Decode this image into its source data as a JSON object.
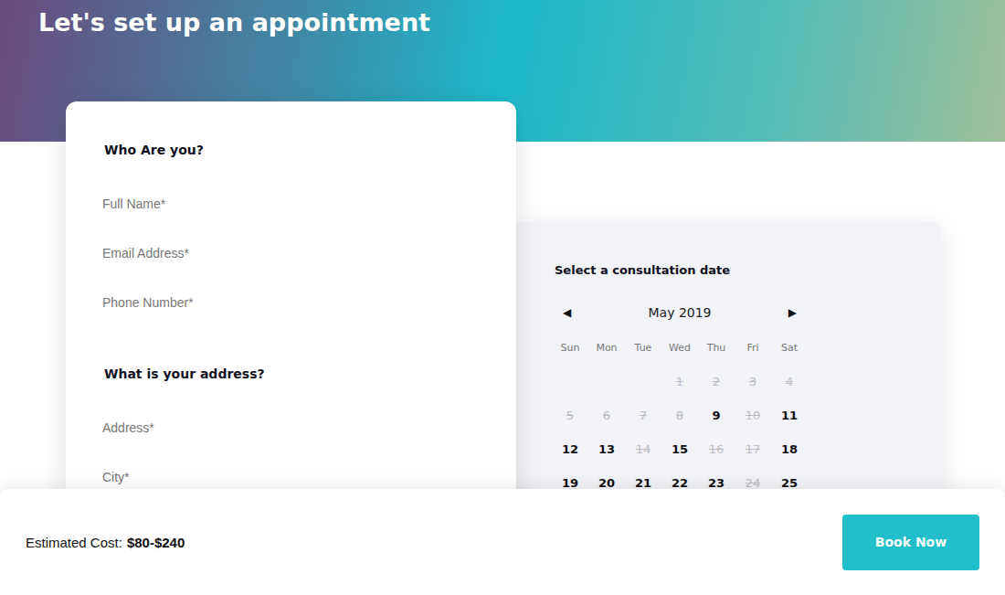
{
  "header": {
    "title": "Let's set up an appointment"
  },
  "form": {
    "sections": [
      {
        "heading": "Who Are you?",
        "fields": [
          {
            "placeholder": "Full Name*"
          },
          {
            "placeholder": "Email Address*"
          },
          {
            "placeholder": "Phone Number*"
          }
        ]
      },
      {
        "heading": "What is your address?",
        "fields": [
          {
            "placeholder": "Address*"
          },
          {
            "placeholder": "City*"
          }
        ]
      }
    ]
  },
  "calendar": {
    "title": "Select a consultation date",
    "month": "May 2019",
    "prev": "◀",
    "next": "▶",
    "weekdays": [
      "Sun",
      "Mon",
      "Tue",
      "Wed",
      "Thu",
      "Fri",
      "Sat"
    ],
    "weeks": [
      [
        {
          "day": "1",
          "available": false
        },
        {
          "day": "2",
          "available": false
        },
        {
          "day": "3",
          "available": false
        },
        {
          "day": "4",
          "available": false
        }
      ],
      [
        {
          "day": "5",
          "available": false
        },
        {
          "day": "6",
          "available": false
        },
        {
          "day": "7",
          "available": false
        },
        {
          "day": "8",
          "available": false
        },
        {
          "day": "9",
          "available": true
        },
        {
          "day": "10",
          "available": false
        },
        {
          "day": "11",
          "available": true
        }
      ],
      [
        {
          "day": "12",
          "available": true
        },
        {
          "day": "13",
          "available": true
        },
        {
          "day": "14",
          "available": false
        },
        {
          "day": "15",
          "available": true
        },
        {
          "day": "16",
          "available": false
        },
        {
          "day": "17",
          "available": false
        },
        {
          "day": "18",
          "available": true
        }
      ],
      [
        {
          "day": "19",
          "available": true
        },
        {
          "day": "20",
          "available": true
        },
        {
          "day": "21",
          "available": true
        },
        {
          "day": "22",
          "available": true
        },
        {
          "day": "23",
          "available": true
        },
        {
          "day": "24",
          "available": false
        },
        {
          "day": "25",
          "available": true
        }
      ]
    ]
  },
  "footer": {
    "estimate_label": "Estimated Cost:",
    "estimate_value": "$80-$240",
    "button": "Book Now"
  }
}
